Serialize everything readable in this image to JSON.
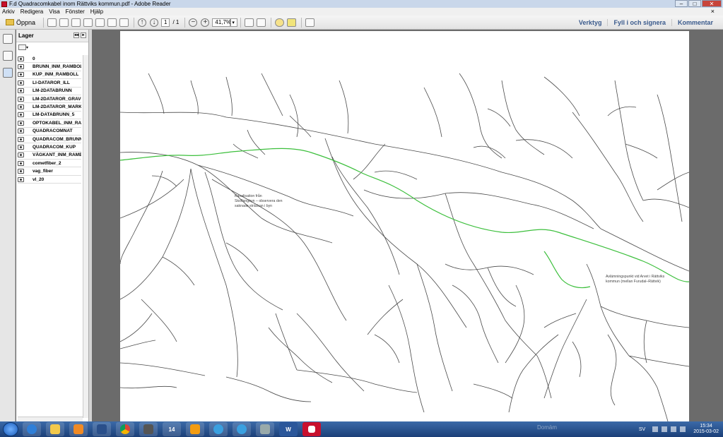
{
  "window": {
    "title": "F.d Quadracomkabel inom Rättviks kommun.pdf - Adobe Reader"
  },
  "menu": {
    "items": [
      "Arkiv",
      "Redigera",
      "Visa",
      "Fönster",
      "Hjälp"
    ],
    "close_symbol": "×"
  },
  "toolbar": {
    "open_label": "Öppna",
    "page_current": "1",
    "page_total": "/ 1",
    "zoom_value": "41,7%",
    "zoom_caret": "▾",
    "minus_symbol": "−",
    "plus_symbol": "+",
    "right": {
      "tools_label": "Verktyg",
      "sign_label": "Fyll i och signera",
      "comment_label": "Kommentar"
    }
  },
  "layers_panel": {
    "title": "Lager",
    "collapse_symbol": "◂◂",
    "expand_symbol": "▸",
    "options_caret": "▾",
    "items": [
      "0",
      "BRUNN_INM_RAMBOL",
      "KUP_INM_RAMBOLL",
      "LI-DATAROR_ILL",
      "LM-2DATABRUNN",
      "LM-2DATAROR_GRAV",
      "LM-2DATAROR_MARK",
      "LM-DATABRUNN_5",
      "OPTOKABEL_INM_RAM",
      "QUADRACOMNAT",
      "QUADRACOM_BRUNN",
      "QUADRACOM_KUP",
      "VÄGKANT_INM_RAMB",
      "cometfiber_2",
      "vag_fiber",
      "vl_20"
    ]
  },
  "map": {
    "route_color": "#3cbf3c",
    "road_color": "#4a4a4a",
    "annotation_left": [
      "Kanalisation från",
      "Skoflangbyn – observera den",
      "saknade sträckan i byn"
    ],
    "annotation_right": [
      "Avlämningspunkt vid Arvet i Rättviks",
      "kommun (mellan Furudal–Rättvik)"
    ]
  },
  "taskbar": {
    "word_label": "W",
    "calendar_label": "14",
    "language": "SV",
    "time": "15:34",
    "date": "2015-03-02",
    "hint": "Domäm"
  }
}
